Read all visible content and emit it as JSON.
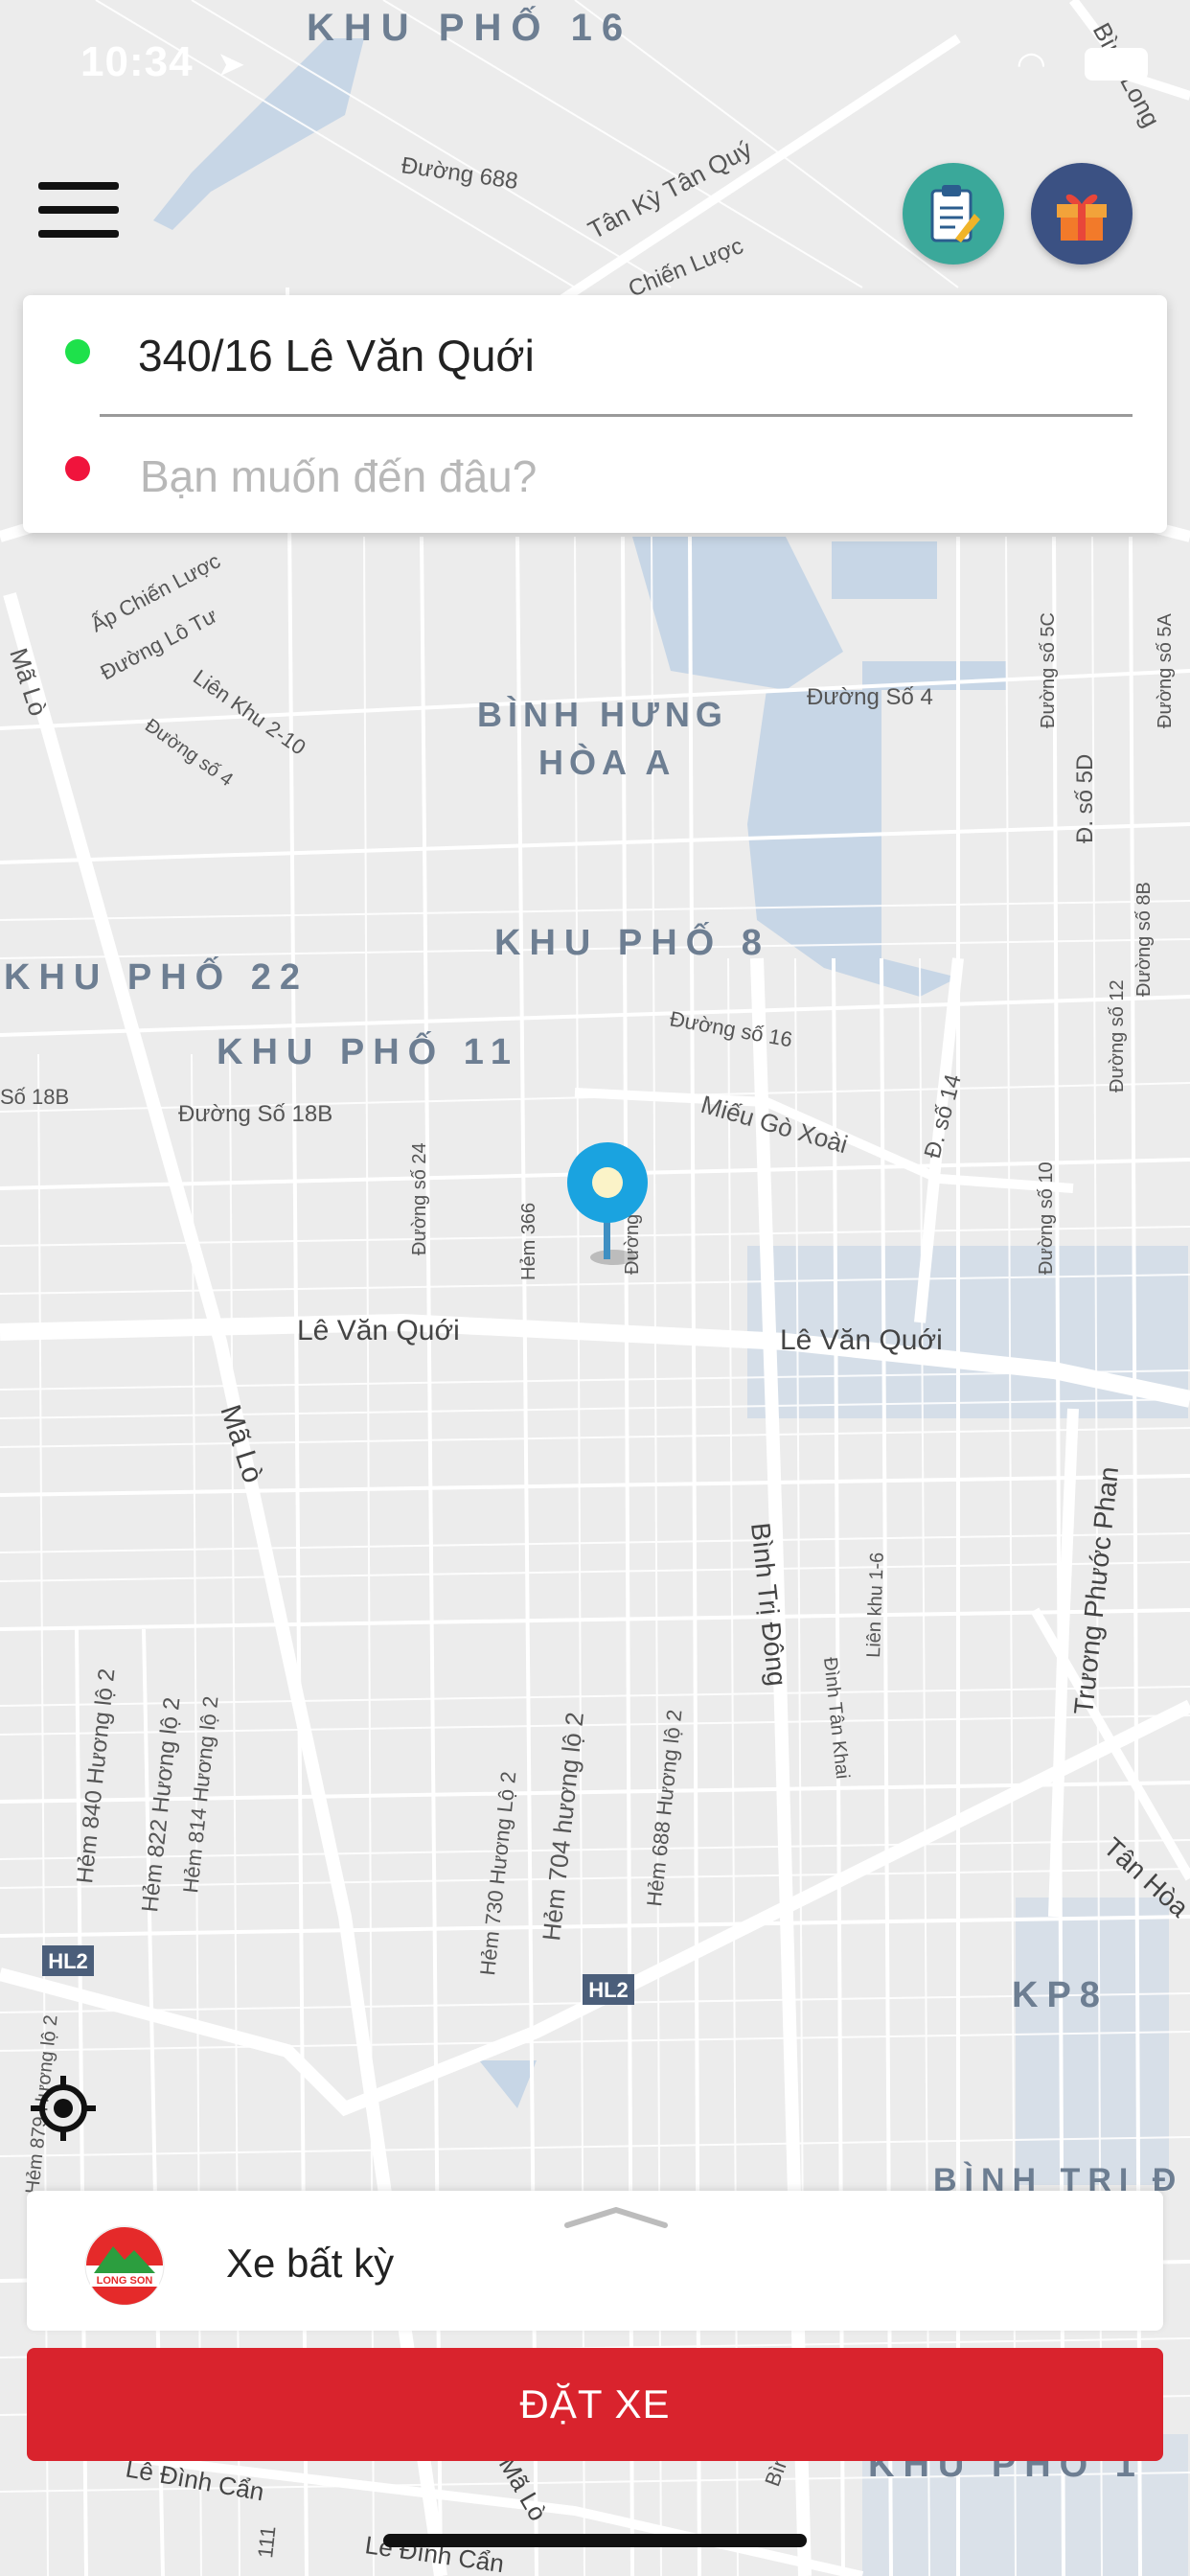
{
  "status_bar": {
    "time": "10:34"
  },
  "map": {
    "labels": [
      {
        "text": "KHU PHỐ 16",
        "style": "area"
      },
      {
        "text": "Đường 688",
        "style": "road"
      },
      {
        "text": "Tân Kỳ Tân Quý",
        "style": "road"
      },
      {
        "text": "Chiến Lược",
        "style": "road"
      },
      {
        "text": "Bình Long",
        "style": "road"
      },
      {
        "text": "Ấp Chiến Lược",
        "style": "road"
      },
      {
        "text": "Đường Lô Tư",
        "style": "road"
      },
      {
        "text": "Liên Khu 2-10",
        "style": "road"
      },
      {
        "text": "Đường số 4",
        "style": "road"
      },
      {
        "text": "Mã Lò",
        "style": "road"
      },
      {
        "text": "BÌNH HƯNG",
        "style": "area"
      },
      {
        "text": "HÒA A",
        "style": "area"
      },
      {
        "text": "Đường Số 4",
        "style": "road"
      },
      {
        "text": "Đường số 5C",
        "style": "road"
      },
      {
        "text": "Đ. số 5D",
        "style": "road"
      },
      {
        "text": "Đường số 5A",
        "style": "road"
      },
      {
        "text": "Đường số 8B",
        "style": "road"
      },
      {
        "text": "Đường số 12",
        "style": "road"
      },
      {
        "text": "KHU PHỐ 8",
        "style": "area"
      },
      {
        "text": "KHU PHỐ 22",
        "style": "area"
      },
      {
        "text": "KHU PHỐ 11",
        "style": "area"
      },
      {
        "text": "Đường số 16",
        "style": "road"
      },
      {
        "text": "Số 18B",
        "style": "road"
      },
      {
        "text": "Đường Số 18B",
        "style": "road"
      },
      {
        "text": "Miếu Gò Xoài",
        "style": "road"
      },
      {
        "text": "Đ. số 14",
        "style": "road"
      },
      {
        "text": "Đường số 24",
        "style": "road"
      },
      {
        "text": "Hẻm 366",
        "style": "road"
      },
      {
        "text": "Đường số 8",
        "style": "road"
      },
      {
        "text": "Đường số 10",
        "style": "road"
      },
      {
        "text": "Lê Văn Quới",
        "style": "road"
      },
      {
        "text": "Lê Văn Quới",
        "style": "road"
      },
      {
        "text": "Mã Lò",
        "style": "road"
      },
      {
        "text": "Bình Trị Đông",
        "style": "road"
      },
      {
        "text": "Trương Phước Phan",
        "style": "road"
      },
      {
        "text": "Đình Tân Khai",
        "style": "road"
      },
      {
        "text": "Liên khu 1-6",
        "style": "road"
      },
      {
        "text": "Hẻm 840 Hương lộ 2",
        "style": "road"
      },
      {
        "text": "Hẻm 822 Hương lộ 2",
        "style": "road"
      },
      {
        "text": "Hẻm 814 Hương lộ 2",
        "style": "road"
      },
      {
        "text": "Hẻm 730 Hương Lộ 2",
        "style": "road"
      },
      {
        "text": "Hẻm 704 hương lộ 2",
        "style": "road"
      },
      {
        "text": "Hẻm 688 Hương lộ 2",
        "style": "road"
      },
      {
        "text": "Tân Hòa",
        "style": "road"
      },
      {
        "text": "KP8",
        "style": "area"
      },
      {
        "text": "BÌNH TRỊ Đ",
        "style": "area"
      },
      {
        "text": "Lê Đình Cẩn",
        "style": "road"
      },
      {
        "text": "Lê Đình Cẩn",
        "style": "road"
      },
      {
        "text": "Mã Lò",
        "style": "road"
      },
      {
        "text": "KHU PHỐ 1",
        "style": "area"
      },
      {
        "text": "Hẻm 879 Hương lộ 2",
        "style": "road"
      },
      {
        "text": "Bình",
        "style": "road"
      },
      {
        "text": "111",
        "style": "road"
      }
    ],
    "shields": [
      "HL2",
      "HL2"
    ]
  },
  "header": {
    "menu_icon": "hamburger-menu-icon",
    "history_icon": "clipboard-pencil-icon",
    "gift_icon": "gift-icon",
    "history_color": "#3aa89a",
    "gift_color": "#3b5183"
  },
  "search": {
    "pickup_address": "340/16 Lê Văn Quới",
    "destination_placeholder": "Bạn muốn đến đâu?",
    "pickup_color": "#1ee14b",
    "destination_color": "#f0143c"
  },
  "vehicle": {
    "label": "Xe bất kỳ",
    "logo_text": "LONG SON"
  },
  "actions": {
    "book_label": "ĐẶT XE",
    "book_color": "#d9232d"
  }
}
